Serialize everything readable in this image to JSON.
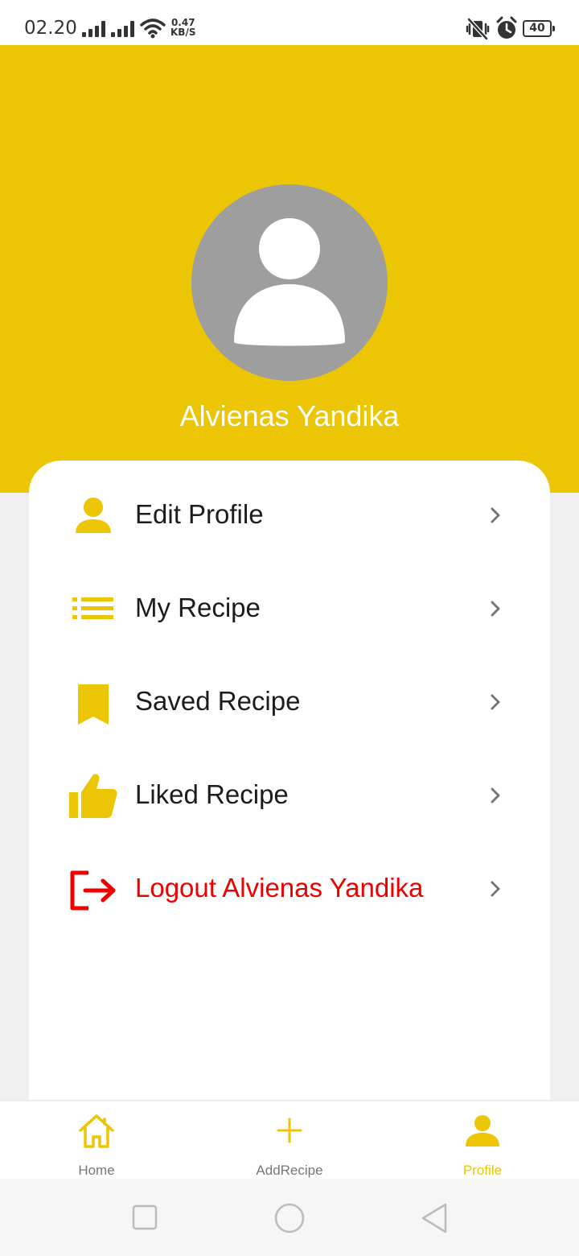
{
  "status_bar": {
    "time": "02.20",
    "net_speed_value": "0.47",
    "net_speed_unit": "KB/S",
    "battery": "40"
  },
  "profile": {
    "name": "Alvienas Yandika"
  },
  "menu": [
    {
      "label": "Edit Profile",
      "icon": "person-icon"
    },
    {
      "label": "My Recipe",
      "icon": "list-icon"
    },
    {
      "label": "Saved Recipe",
      "icon": "bookmark-icon"
    },
    {
      "label": "Liked Recipe",
      "icon": "thumbs-up-icon"
    },
    {
      "label": "Logout Alvienas Yandika",
      "icon": "logout-icon"
    }
  ],
  "bottom_nav": [
    {
      "label": "Home",
      "icon": "home-icon",
      "active": false
    },
    {
      "label": "AddRecipe",
      "icon": "plus-icon",
      "active": false
    },
    {
      "label": "Profile",
      "icon": "person-icon",
      "active": true
    }
  ],
  "colors": {
    "accent": "#ecc504",
    "danger": "#ee0000",
    "avatar_bg": "#9e9e9e"
  }
}
